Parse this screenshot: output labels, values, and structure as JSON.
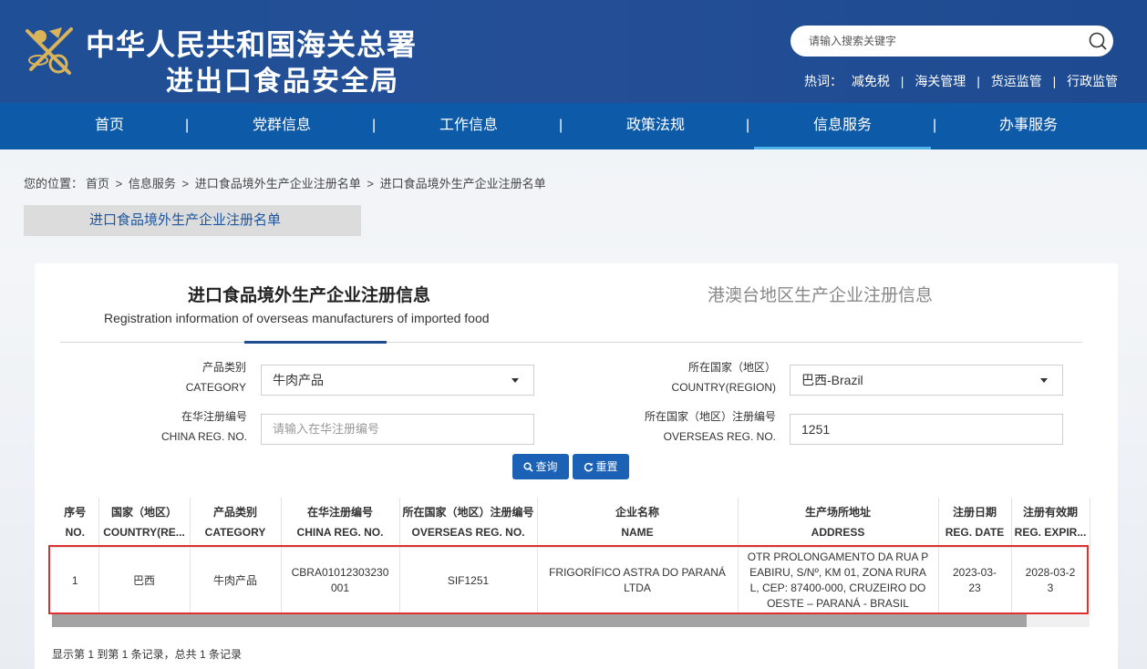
{
  "header": {
    "title_line1": "中华人民共和国海关总署",
    "title_line2": "进出口食品安全局",
    "search_placeholder": "请输入搜索关键字",
    "hot_label": "热词：",
    "hot_words": [
      "减免税",
      "海关管理",
      "货运监管",
      "行政监管"
    ],
    "hot_sep": "|"
  },
  "nav": {
    "items": [
      "首页",
      "党群信息",
      "工作信息",
      "政策法规",
      "信息服务",
      "办事服务"
    ],
    "sep": "|",
    "active": "信息服务"
  },
  "breadcrumb": {
    "label": "您的位置：",
    "items": [
      "首页",
      "信息服务",
      "进口食品境外生产企业注册名单",
      "进口食品境外生产企业注册名单"
    ],
    "sep": ">"
  },
  "side_tab": "进口食品境外生产企业注册名单",
  "tabs": {
    "active_title": "进口食品境外生产企业注册信息",
    "active_subtitle": "Registration information of overseas manufacturers of imported food",
    "other_title": "港澳台地区生产企业注册信息"
  },
  "form": {
    "category_label_cn": "产品类别",
    "category_label_en": "CATEGORY",
    "category_value": "牛肉产品",
    "country_label_cn": "所在国家（地区）",
    "country_label_en": "COUNTRY(REGION)",
    "country_value": "巴西-Brazil",
    "china_reg_label_cn": "在华注册编号",
    "china_reg_label_en": "CHINA REG. NO.",
    "china_reg_placeholder": "请输入在华注册编号",
    "overseas_reg_label_cn": "所在国家（地区）注册编号",
    "overseas_reg_label_en": "OVERSEAS REG. NO.",
    "overseas_reg_value": "1251",
    "query_button": "查询",
    "reset_button": "重置"
  },
  "table": {
    "headers": [
      {
        "cn": "序号",
        "en": "NO."
      },
      {
        "cn": "国家（地区）",
        "en": "COUNTRY(RE..."
      },
      {
        "cn": "产品类别",
        "en": "CATEGORY"
      },
      {
        "cn": "在华注册编号",
        "en": "CHINA REG. NO."
      },
      {
        "cn": "所在国家（地区）注册编号",
        "en": "OVERSEAS REG. NO."
      },
      {
        "cn": "企业名称",
        "en": "NAME"
      },
      {
        "cn": "生产场所地址",
        "en": "ADDRESS"
      },
      {
        "cn": "注册日期",
        "en": "REG. DATE"
      },
      {
        "cn": "注册有效期",
        "en": "REG. EXPIR..."
      }
    ],
    "rows": [
      [
        "1",
        "巴西",
        "牛肉产品",
        "CBRA01012303230001",
        "SIF1251",
        "FRIGORÍFICO ASTRA DO PARANÁ LTDA",
        "OTR PROLONGAMENTO DA RUA PEABIRU, S/Nº, KM 01, ZONA RURAL, CEP: 87400-000, CRUZEIRO DO OESTE – PARANÁ - BRASIL",
        "2023-03-23",
        "2028-03-23"
      ]
    ]
  },
  "footer_note": "显示第 1 到第 1 条记录，总共 1 条记录",
  "colors": {
    "header_bg": "#1f4f96",
    "nav_bg": "#0d5aa8",
    "button_bg": "#1b61b5",
    "highlight": "#e0302d"
  }
}
